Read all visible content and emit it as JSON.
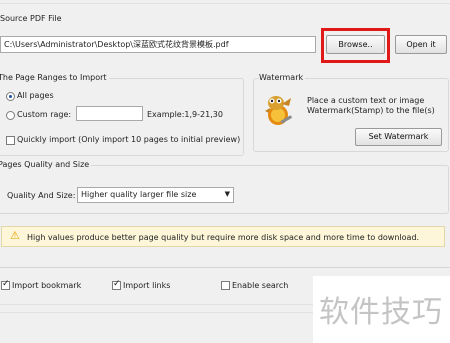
{
  "source": {
    "legend": "Source PDF File",
    "path_value": "C:\\Users\\Administrator\\Desktop\\深蓝欧式花纹背景模板.pdf",
    "browse_label": "Browse..",
    "open_label": "Open it"
  },
  "page_ranges": {
    "legend": "The Page Ranges to Import",
    "all_pages_label": "All pages",
    "all_pages_selected": true,
    "custom_range_label": "Custom rage:",
    "custom_range_value": "",
    "example_label": "Example:1,9-21,30",
    "quick_import_label": "Quickly import (Only import 10 pages to  initial  preview)",
    "quick_import_checked": false
  },
  "watermark": {
    "legend": "Watermark",
    "description": "Place a custom text or image Watermark(Stamp) to the file(s)",
    "icon": "gimp-mascot-icon",
    "button_label": "Set Watermark"
  },
  "quality": {
    "legend": "Pages Quality and Size",
    "label": "Quality And Size:",
    "selected": "Higher quality larger file size"
  },
  "notice": {
    "icon": "warning-icon",
    "text": "High values produce better page quality but require more disk space and more time to download."
  },
  "options": {
    "import_bookmark_label": "Import bookmark",
    "import_bookmark_checked": true,
    "import_links_label": "Import links",
    "import_links_checked": true,
    "enable_search_label": "Enable search",
    "enable_search_checked": false
  },
  "watermark_overlay": "软件技巧",
  "colors": {
    "highlight_box": "#e01818",
    "notice_bg": "#fdf6d8",
    "warning": "#e8a000"
  }
}
